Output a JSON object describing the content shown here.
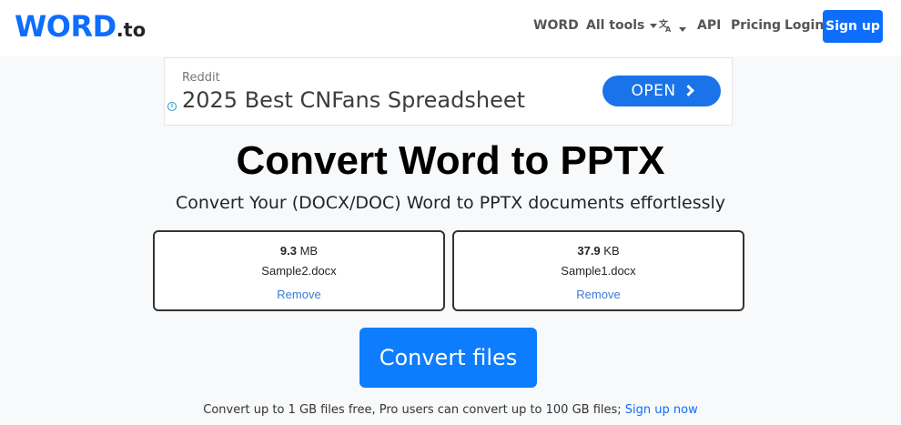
{
  "brand": {
    "logo_main": "WORD",
    "logo_tld": ".to"
  },
  "nav": {
    "word": "WORD",
    "all_tools": "All tools",
    "language_icon": "translate-icon",
    "api": "API",
    "pricing": "Pricing",
    "login": "Login",
    "signup": "Sign up"
  },
  "ad": {
    "source": "Reddit",
    "headline": "2025 Best CNFans Spreadsheet",
    "cta": "OPEN",
    "info_icon": "info-icon"
  },
  "main": {
    "title": "Convert Word to PPTX",
    "subtitle": "Convert Your (DOCX/DOC) Word to PPTX documents effortlessly"
  },
  "files": [
    {
      "size_value": "9.3",
      "size_unit": "MB",
      "name": "Sample2.docx",
      "remove_label": "Remove"
    },
    {
      "size_value": "37.9",
      "size_unit": "KB",
      "name": "Sample1.docx",
      "remove_label": "Remove"
    }
  ],
  "convert": {
    "label": "Convert files"
  },
  "footer": {
    "note": "Convert up to 1 GB files free, Pro users can convert up to 100 GB files;",
    "signup_link": "Sign up now"
  },
  "colors": {
    "primary": "#0d6efd",
    "ad_button": "#1a73e8",
    "background": "#f8f9fa"
  }
}
